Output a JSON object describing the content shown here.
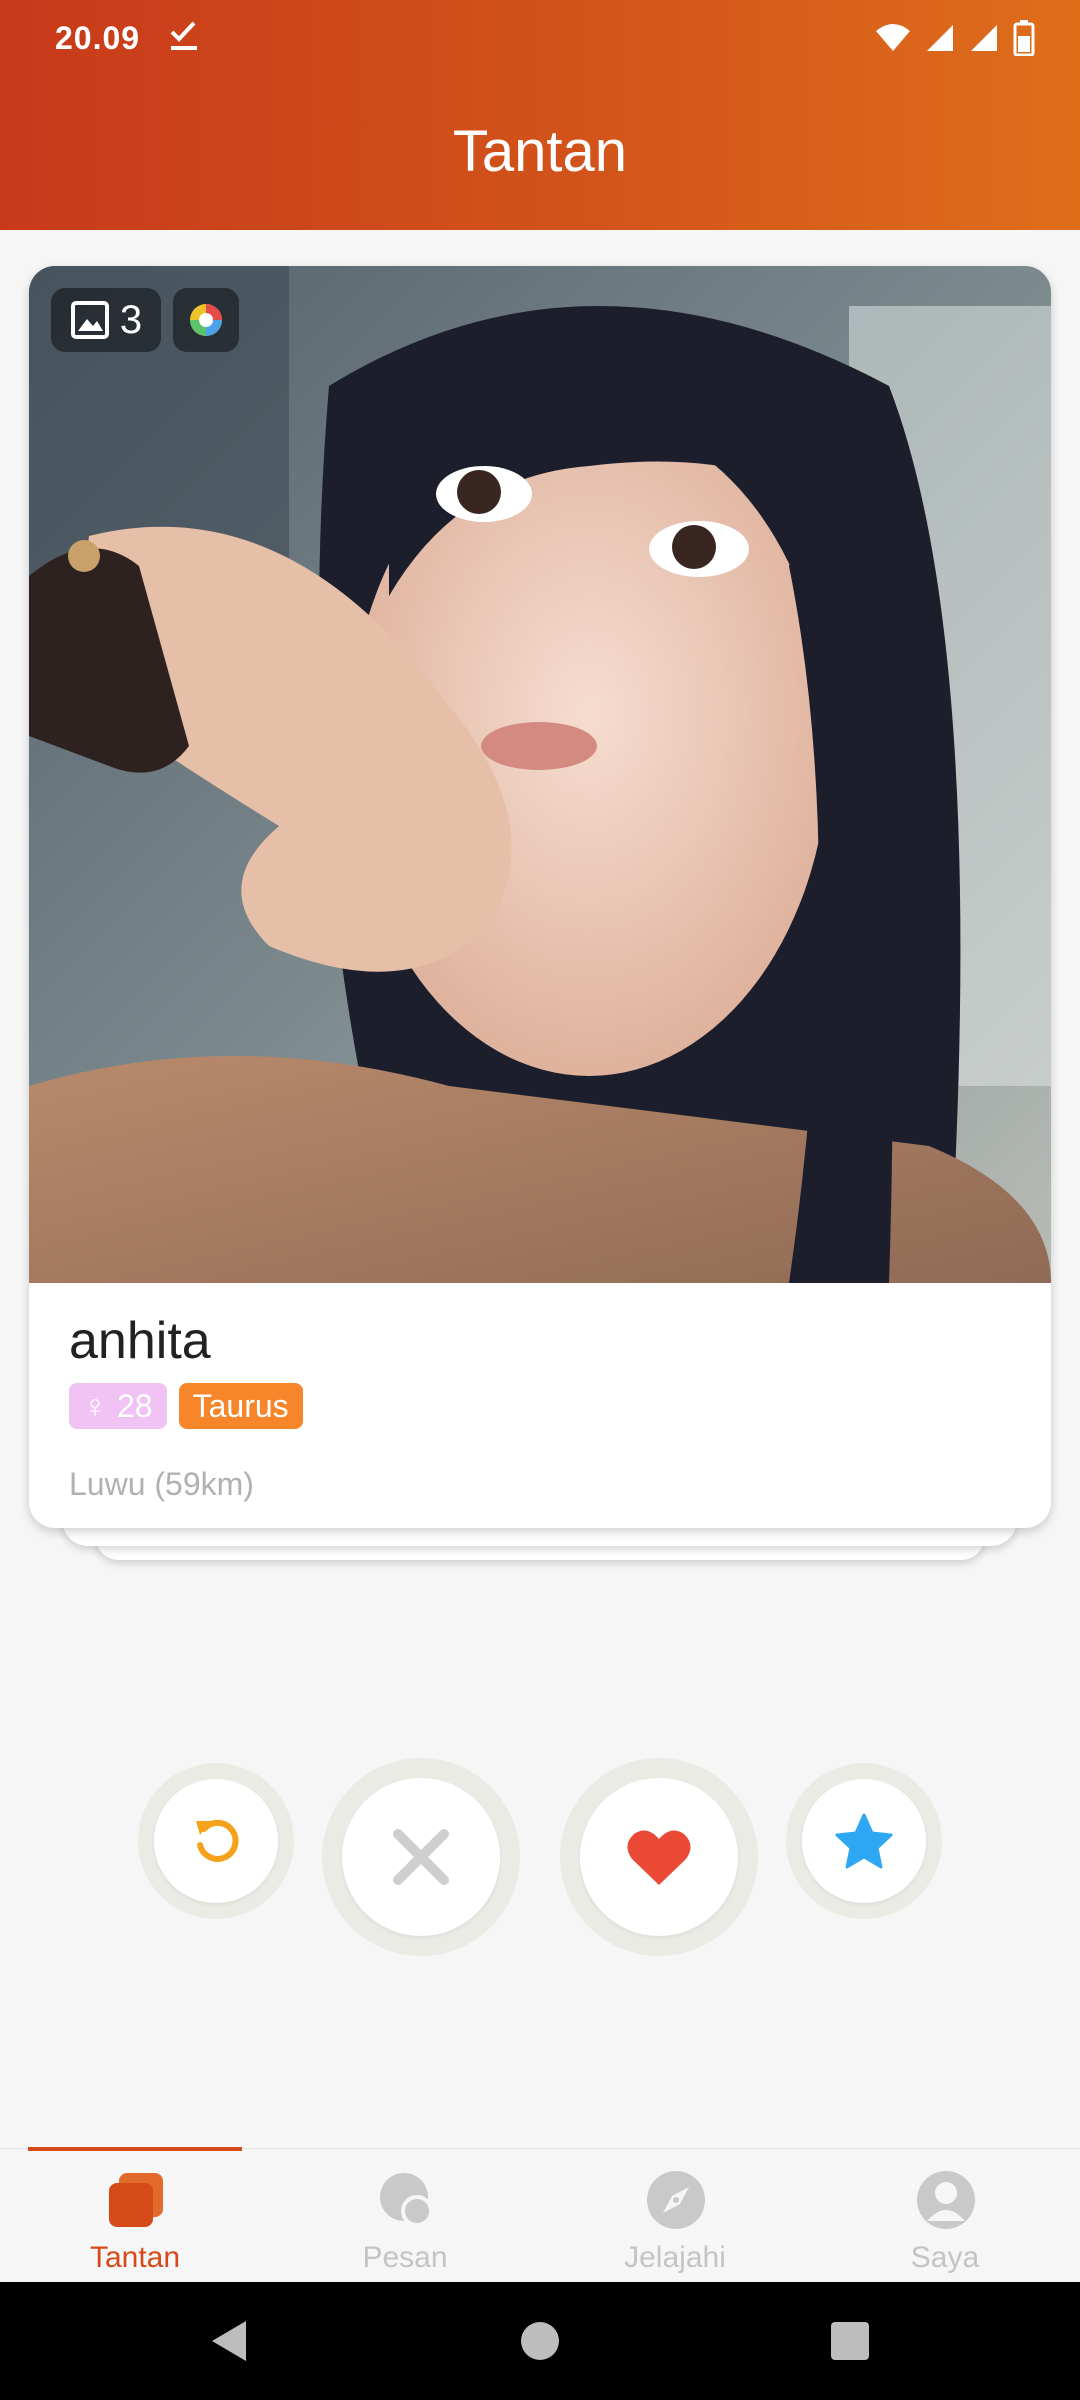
{
  "status_bar": {
    "time": "20.09",
    "icons": [
      "download-done-icon",
      "wifi-icon",
      "signal-icon",
      "signal-icon",
      "battery-icon"
    ]
  },
  "header": {
    "title": "Tantan"
  },
  "card": {
    "photo_count": "3",
    "name": "anhita",
    "gender_symbol": "♀",
    "age": "28",
    "zodiac": "Taurus",
    "location": "Luwu (59km)"
  },
  "actions": {
    "rewind": "rewind-icon",
    "nope": "close-icon",
    "like": "heart-icon",
    "super_like": "star-icon"
  },
  "bottom_nav": {
    "items": [
      {
        "label": "Tantan",
        "icon": "cards-icon",
        "active": true
      },
      {
        "label": "Pesan",
        "icon": "chat-bubbles-icon",
        "active": false
      },
      {
        "label": "Jelajahi",
        "icon": "compass-icon",
        "active": false
      },
      {
        "label": "Saya",
        "icon": "person-icon",
        "active": false
      }
    ]
  },
  "colors": {
    "header_start": "#c8391a",
    "header_end": "#df6e1b",
    "accent": "#d64a1a",
    "gender_tag": "#f1c3f4",
    "zodiac_tag": "#f7852a",
    "nope": "#cfcfcf",
    "like": "#ea4a35",
    "rewind": "#f4a21c",
    "super_like": "#2ea8f2"
  }
}
